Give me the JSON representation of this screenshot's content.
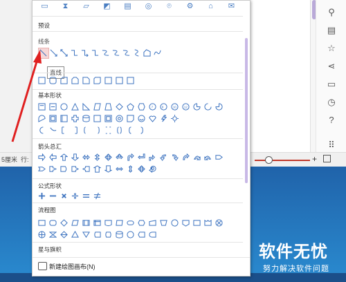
{
  "panel": {
    "sections": {
      "presets": "预设",
      "lines": "线条",
      "basic": "基本形状",
      "arrows": "箭头总汇",
      "formula": "公式形状",
      "flowchart": "流程图",
      "stars": "星与旗帜"
    },
    "tooltip": "直线",
    "new_canvas": "新建绘图画布(N)"
  },
  "status": {
    "unit": "5厘米",
    "row": "行:"
  },
  "watermark": {
    "title": "软件无忧",
    "subtitle": "努力解决软件问题"
  },
  "colors": {
    "accent": "#4a7ec2",
    "annotation_arrow": "#e02020",
    "hover_fill": "#f6d7d7"
  },
  "icons": {
    "top_row": [
      "monitor-icon",
      "hourglass-icon",
      "comment-icon",
      "thumbs-up-icon",
      "document-icon",
      "magnify-icon",
      "location-pin-icon",
      "gear-icon",
      "tombstone-icon",
      "envelope-icon"
    ],
    "sidebar": [
      "slider-icon",
      "doc-page-icon",
      "star-icon",
      "share-icon",
      "archive-icon",
      "history-icon",
      "help-icon",
      "grid-icon"
    ]
  }
}
